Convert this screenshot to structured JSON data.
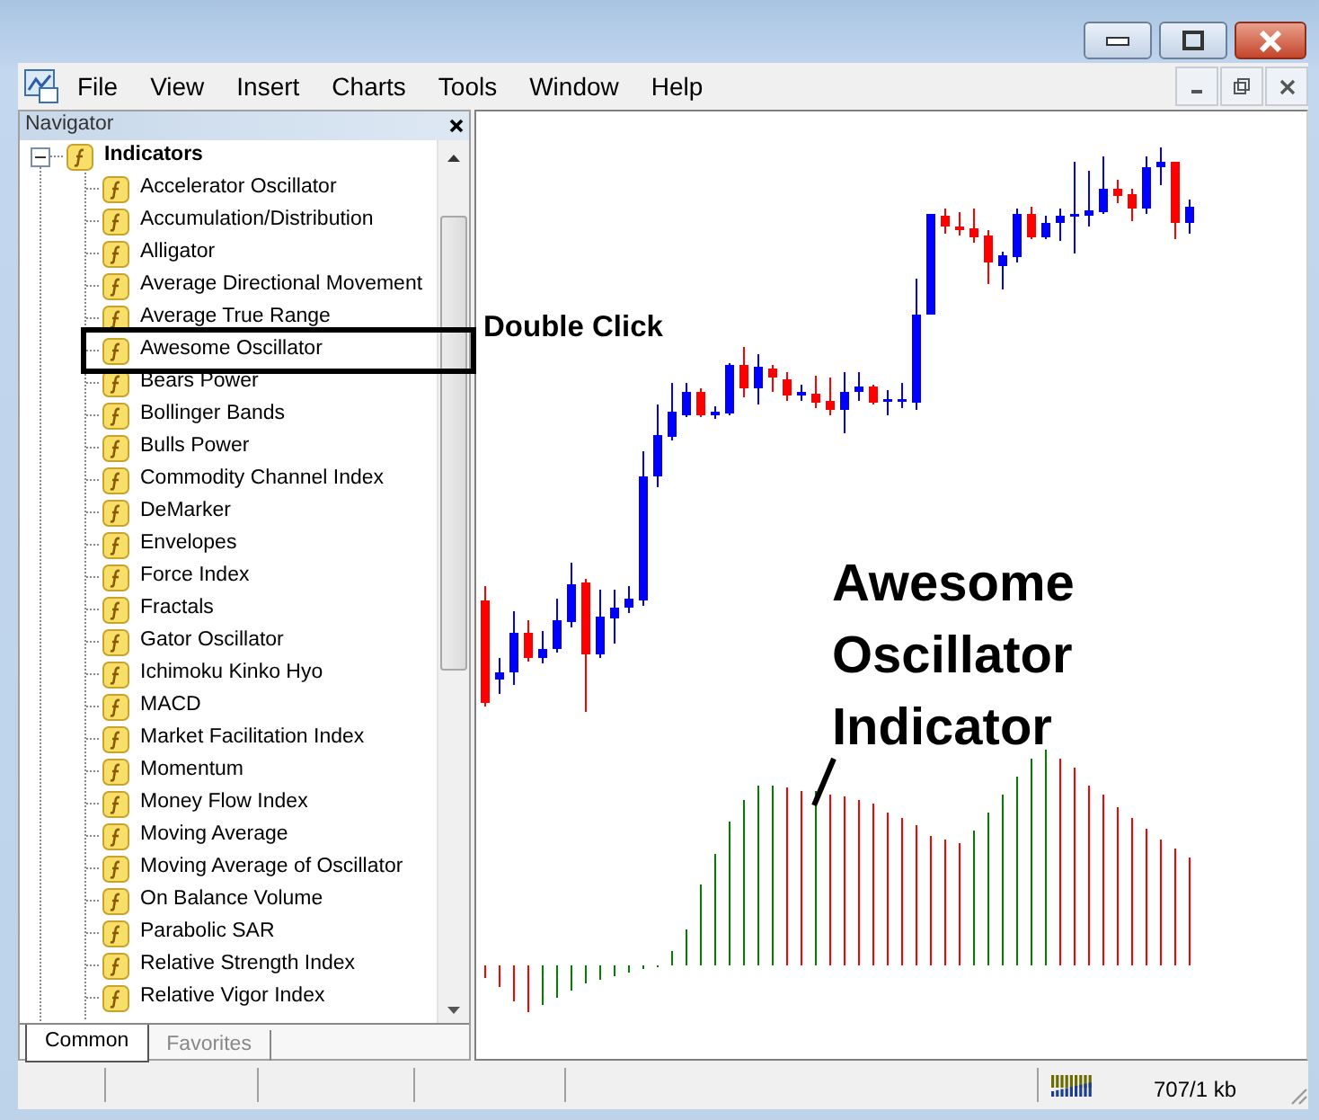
{
  "menu": [
    "File",
    "View",
    "Insert",
    "Charts",
    "Tools",
    "Window",
    "Help"
  ],
  "navigator": {
    "title": "Navigator",
    "tree": {
      "label": "Indicators",
      "expanded": true,
      "children": [
        {
          "label": "Accelerator Oscillator",
          "annotated": false
        },
        {
          "label": "Accumulation/Distribution",
          "annotated": false
        },
        {
          "label": "Alligator",
          "annotated": false
        },
        {
          "label": "Average Directional Movement",
          "annotated": false
        },
        {
          "label": "Average True Range",
          "annotated": false
        },
        {
          "label": "Awesome Oscillator",
          "annotated": true
        },
        {
          "label": "Bears Power",
          "annotated": false
        },
        {
          "label": "Bollinger Bands",
          "annotated": false
        },
        {
          "label": "Bulls Power",
          "annotated": false
        },
        {
          "label": "Commodity Channel Index",
          "annotated": false
        },
        {
          "label": "DeMarker",
          "annotated": false
        },
        {
          "label": "Envelopes",
          "annotated": false
        },
        {
          "label": "Force Index",
          "annotated": false
        },
        {
          "label": "Fractals",
          "annotated": false
        },
        {
          "label": "Gator Oscillator",
          "annotated": false
        },
        {
          "label": "Ichimoku Kinko Hyo",
          "annotated": false
        },
        {
          "label": "MACD",
          "annotated": false
        },
        {
          "label": "Market Facilitation Index",
          "annotated": false
        },
        {
          "label": "Momentum",
          "annotated": false
        },
        {
          "label": "Money Flow Index",
          "annotated": false
        },
        {
          "label": "Moving Average",
          "annotated": false
        },
        {
          "label": "Moving Average of Oscillator",
          "annotated": false
        },
        {
          "label": "On Balance Volume",
          "annotated": false
        },
        {
          "label": "Parabolic SAR",
          "annotated": false
        },
        {
          "label": "Relative Strength Index",
          "annotated": false
        },
        {
          "label": "Relative Vigor Index",
          "annotated": false
        }
      ]
    },
    "tabs": [
      {
        "label": "Common",
        "selected": true
      },
      {
        "label": "Favorites",
        "selected": false
      }
    ]
  },
  "chart": {
    "annotation": "Double Click",
    "callout": "Awesome Oscillator Indicator"
  },
  "status_bar": {
    "memory": "707/1 kb"
  }
}
